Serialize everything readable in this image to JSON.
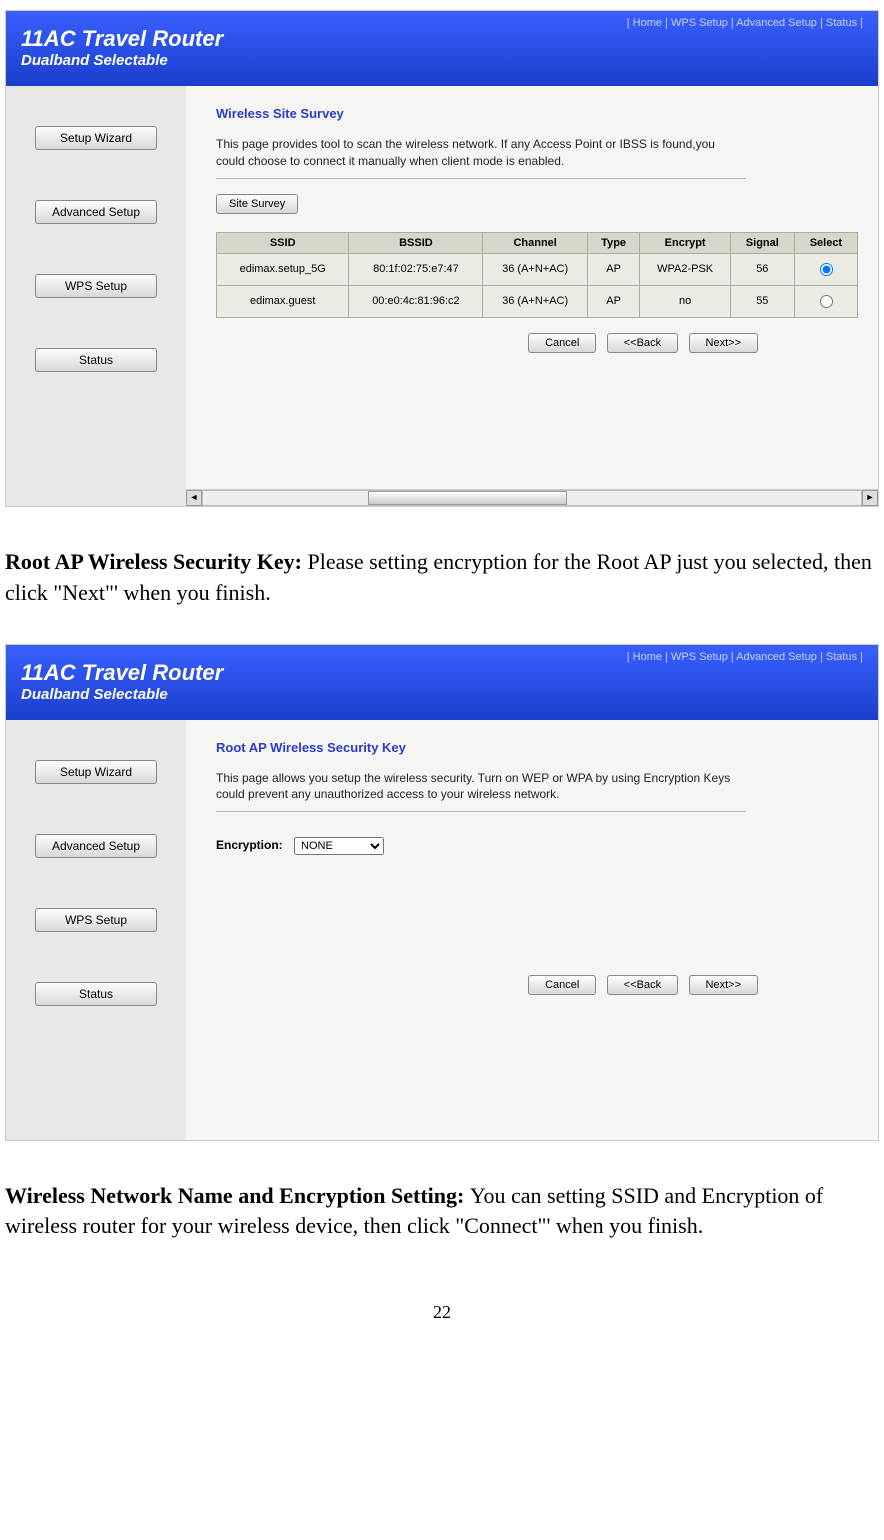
{
  "header": {
    "title": "11AC Travel Router",
    "subtitle": "Dualband Selectable",
    "links_text": "| Home | WPS Setup | Advanced Setup | Status |"
  },
  "sidebar": {
    "btn1": "Setup Wizard",
    "btn2": "Advanced Setup",
    "btn3": "WPS Setup",
    "btn4": "Status"
  },
  "panel1": {
    "title": "Wireless Site Survey",
    "desc": "This page provides tool to scan the wireless network. If any Access Point or IBSS is found,you could choose to connect it manually when client mode is enabled.",
    "survey_btn": "Site Survey",
    "table": {
      "headers": {
        "ssid": "SSID",
        "bssid": "BSSID",
        "channel": "Channel",
        "type": "Type",
        "encrypt": "Encrypt",
        "signal": "Signal",
        "select": "Select"
      },
      "rows": [
        {
          "ssid": "edimax.setup_5G",
          "bssid": "80:1f:02:75:e7:47",
          "channel": "36 (A+N+AC)",
          "type": "AP",
          "encrypt": "WPA2-PSK",
          "signal": "56",
          "selected": true
        },
        {
          "ssid": "edimax.guest",
          "bssid": "00:e0:4c:81:96:c2",
          "channel": "36 (A+N+AC)",
          "type": "AP",
          "encrypt": "no",
          "signal": "55",
          "selected": false
        }
      ]
    },
    "actions": {
      "cancel": "Cancel",
      "back": "<<Back",
      "next": "Next>>"
    }
  },
  "doc1": {
    "bold": "Root AP Wireless Security Key: ",
    "rest": "Please setting encryption for the Root AP just you selected, then click \"Next\"' when you finish."
  },
  "panel2": {
    "title": "Root AP Wireless Security Key",
    "desc": "This page allows you setup the wireless security. Turn on WEP or WPA by using Encryption Keys could prevent any unauthorized access to your wireless network.",
    "enc_label": "Encryption:",
    "enc_value": "NONE",
    "actions": {
      "cancel": "Cancel",
      "back": "<<Back",
      "next": "Next>>"
    }
  },
  "doc2": {
    "bold": "Wireless Network Name and Encryption Setting: ",
    "rest": "You can setting SSID and Encryption of wireless router for your wireless device, then click \"Connect\"' when you finish."
  },
  "page_number": "22"
}
